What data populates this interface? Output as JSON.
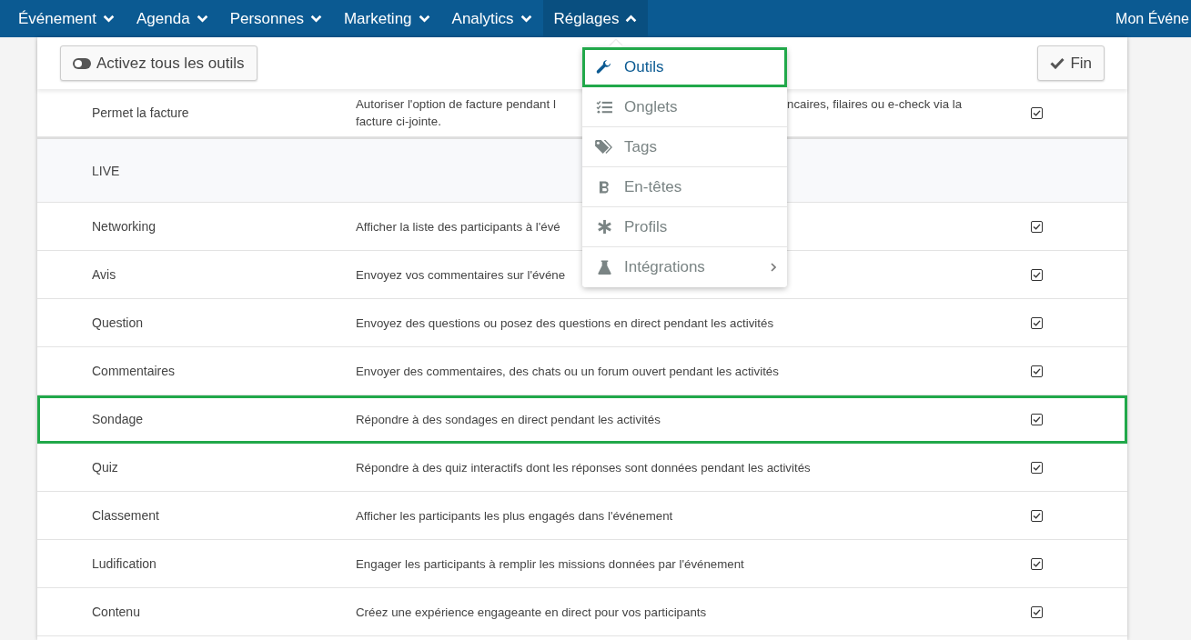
{
  "nav": {
    "items": [
      {
        "label": "Événement",
        "expanded": false
      },
      {
        "label": "Agenda",
        "expanded": false
      },
      {
        "label": "Personnes",
        "expanded": false
      },
      {
        "label": "Marketing",
        "expanded": false
      },
      {
        "label": "Analytics",
        "expanded": false
      },
      {
        "label": "Réglages",
        "expanded": true
      }
    ],
    "event_name": "Mon Événe"
  },
  "toolbar": {
    "toggle_button": "Activez tous les outils",
    "done_button": "Fin"
  },
  "settings_menu": {
    "items": [
      {
        "label": "Outils",
        "selected": true,
        "highlighted": true,
        "submenu": false
      },
      {
        "label": "Onglets",
        "selected": false,
        "highlighted": false,
        "submenu": false
      },
      {
        "label": "Tags",
        "selected": false,
        "highlighted": false,
        "submenu": false
      },
      {
        "label": "En-têtes",
        "selected": false,
        "highlighted": false,
        "submenu": false
      },
      {
        "label": "Profils",
        "selected": false,
        "highlighted": false,
        "submenu": false
      },
      {
        "label": "Intégrations",
        "selected": false,
        "highlighted": false,
        "submenu": true
      }
    ]
  },
  "rows": [
    {
      "kind": "tool",
      "name": "Permet la facture",
      "description": [
        {
          "text": "Autoriser l'option de facture pendant l",
          "after": "ncaires, filaires ou e-check via la"
        },
        {
          "text": "facture ci-jointe."
        }
      ],
      "checked": true,
      "highlighted": false
    },
    {
      "kind": "section",
      "name": "LIVE"
    },
    {
      "kind": "tool",
      "name": "Networking",
      "description": [
        {
          "text": "Afficher la liste des participants à l'évé"
        }
      ],
      "checked": true,
      "highlighted": false
    },
    {
      "kind": "tool",
      "name": "Avis",
      "description": [
        {
          "text": "Envoyez vos commentaires sur l'événe"
        }
      ],
      "checked": true,
      "highlighted": false
    },
    {
      "kind": "tool",
      "name": "Question",
      "description": [
        {
          "text": "Envoyez des questions ou posez des questions en direct pendant les activités"
        }
      ],
      "checked": true,
      "highlighted": false
    },
    {
      "kind": "tool",
      "name": "Commentaires",
      "description": [
        {
          "text": "Envoyer des commentaires, des chats ou un forum ouvert pendant les activités"
        }
      ],
      "checked": true,
      "highlighted": false
    },
    {
      "kind": "tool",
      "name": "Sondage",
      "description": [
        {
          "text": "Répondre à des sondages en direct pendant les activités"
        }
      ],
      "checked": true,
      "highlighted": true
    },
    {
      "kind": "tool",
      "name": "Quiz",
      "description": [
        {
          "text": "Répondre à des quiz interactifs dont les réponses sont données pendant les activités"
        }
      ],
      "checked": true,
      "highlighted": false
    },
    {
      "kind": "tool",
      "name": "Classement",
      "description": [
        {
          "text": "Afficher les participants les plus engagés dans l'événement"
        }
      ],
      "checked": true,
      "highlighted": false
    },
    {
      "kind": "tool",
      "name": "Ludification",
      "description": [
        {
          "text": "Engager les participants à remplir les missions données par l'événement"
        }
      ],
      "checked": true,
      "highlighted": false
    },
    {
      "kind": "tool",
      "name": "Contenu",
      "description": [
        {
          "text": "Créez une expérience engageante en direct pour vos participants"
        }
      ],
      "checked": true,
      "highlighted": false
    }
  ]
}
